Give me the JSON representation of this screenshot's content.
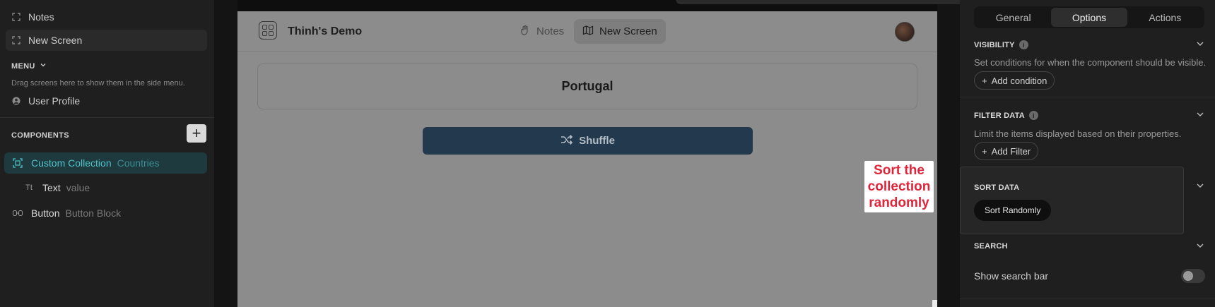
{
  "left_sidebar": {
    "screens": [
      {
        "label": "Notes",
        "icon": "screen-icon"
      },
      {
        "label": "New Screen",
        "icon": "screen-icon"
      }
    ],
    "menu_title": "MENU",
    "menu_hint": "Drag screens here to show them in the side menu.",
    "menu_items": [
      {
        "label": "User Profile",
        "icon": "user-icon"
      }
    ],
    "components_title": "COMPONENTS",
    "components": [
      {
        "label": "Custom Collection",
        "sub": "Countries",
        "icon": "collection-icon",
        "selected": true
      },
      {
        "label": "Text",
        "sub": "value",
        "icon": "text-icon",
        "glyph": "Tt"
      },
      {
        "label": "Button",
        "sub": "Button Block",
        "icon": "button-icon"
      }
    ]
  },
  "preview": {
    "app_title": "Thinh's Demo",
    "nav": [
      {
        "label": "Notes",
        "icon": "hand-icon"
      },
      {
        "label": "New Screen",
        "icon": "map-icon",
        "active": true
      }
    ],
    "card_text": "Portugal",
    "shuffle_label": "Shuffle",
    "callout": "Sort the collection randomly"
  },
  "right_panel": {
    "tabs": [
      {
        "label": "General"
      },
      {
        "label": "Options",
        "active": true
      },
      {
        "label": "Actions"
      }
    ],
    "visibility": {
      "title": "VISIBILITY",
      "desc": "Set conditions for when the component should be visible.",
      "button": "Add condition"
    },
    "filter": {
      "title": "FILTER DATA",
      "desc": "Limit the items displayed based on their properties.",
      "button": "Add Filter"
    },
    "sort": {
      "title": "SORT DATA",
      "button": "Sort Randomly"
    },
    "search": {
      "title": "SEARCH",
      "toggle_label": "Show search bar",
      "toggle_on": false
    }
  },
  "colors": {
    "accent": "#4fc3c9",
    "shuffle_bg": "#23394d",
    "callout_text": "#e0243a"
  }
}
